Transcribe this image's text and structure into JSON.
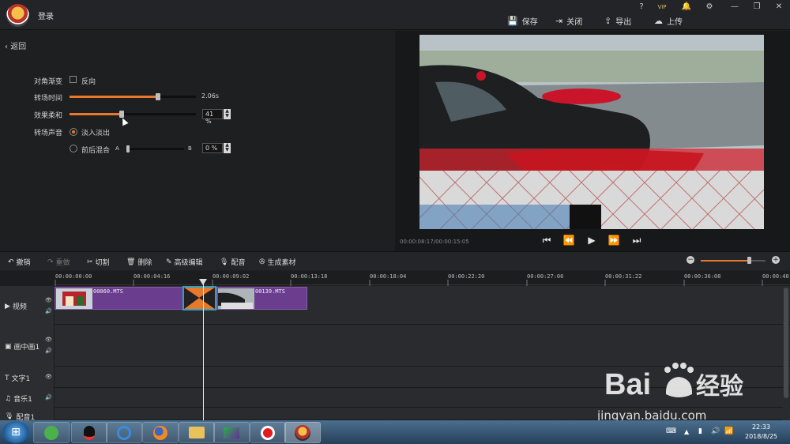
{
  "titlebar": {
    "login": "登录",
    "window_controls": [
      "?",
      "VIP",
      "🔔",
      "⚙",
      "—",
      "❐",
      "✕"
    ],
    "actions": [
      {
        "icon": "save-icon",
        "label": "保存"
      },
      {
        "icon": "close-icon",
        "label": "关闭"
      },
      {
        "icon": "export-icon",
        "label": "导出"
      },
      {
        "icon": "upload-icon",
        "label": "上传"
      }
    ]
  },
  "panel": {
    "back": "返回",
    "diagonal_label": "对角渐变",
    "reverse_label": "反向",
    "duration_label": "转场时间",
    "duration_value": "2.06s",
    "duration_fraction": 0.7,
    "softness_label": "效果柔和",
    "softness_value": "41",
    "softness_unit": "%",
    "softness_fraction": 0.41,
    "sound_label": "转场声音",
    "fade_label": "淡入淡出",
    "mix_label": "前后混合",
    "mix_a": "A",
    "mix_b": "B",
    "mix_value": "0",
    "mix_unit": "%",
    "mix_fraction": 0.0
  },
  "preview": {
    "timecode": "00:00:08:17/00:00:15:05"
  },
  "toolbar": {
    "undo": "撤销",
    "redo": "重做",
    "cut": "切割",
    "delete": "删除",
    "advanced_edit": "高级编辑",
    "dub": "配音",
    "generate": "生成素材",
    "zoom_fraction": 0.75
  },
  "ruler": {
    "ticks": [
      "00:00:00:00",
      "00:00:04:16",
      "00:00:09:02",
      "00:00:13:18",
      "00:00:18:04",
      "00:00:22:20",
      "00:00:27:06",
      "00:00:31:22",
      "00:00:36:08",
      "00:00:40"
    ]
  },
  "tracks": {
    "video": "视频",
    "pip": "画中画1",
    "text": "文字1",
    "music": "音乐1",
    "dub": "配音1"
  },
  "clips": {
    "clip1": "00060.MTS",
    "clip2": "00139.MTS"
  },
  "taskbar": {
    "time": "22:33",
    "date": "2018/8/25"
  },
  "watermark": {
    "text": "jingyan.baidu.com"
  }
}
